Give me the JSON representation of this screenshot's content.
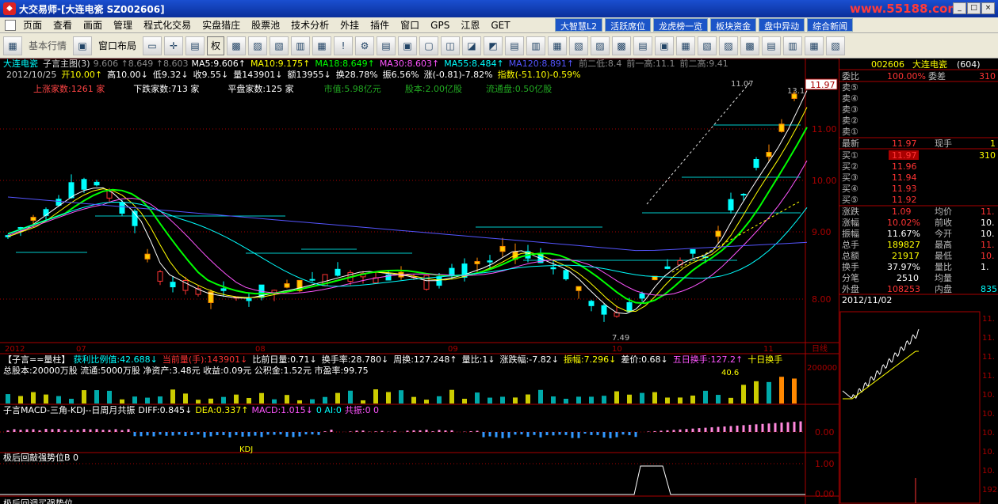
{
  "titlebar": {
    "app": "大交易师",
    "sep": " - ",
    "title": "[大连电瓷 SZ002606]",
    "site": "www.55188.com",
    "btns": [
      "_",
      "□",
      "×"
    ]
  },
  "menu": [
    "页面",
    "查看",
    "画面",
    "管理",
    "程式化交易",
    "实盘猎庄",
    "股票池",
    "技术分析",
    "外挂",
    "插件",
    "窗口",
    "GPS",
    "江恩",
    "GET"
  ],
  "topbtns": [
    "大智慧L2",
    "活跃席位",
    "龙虎榜一览",
    "板块资金",
    "盘中异动",
    "综合新闻"
  ],
  "toolbar": {
    "items": [
      "基本行情",
      "窗口布局",
      "权"
    ]
  },
  "chart_header": {
    "stock": "大连电瓷",
    "main": "子言主图(3)",
    "vals": "9.606 ↑8.649 ↑8.603",
    "ma": [
      {
        "t": "MA5:9.606↑",
        "c": "#ffffff"
      },
      {
        "t": "MA10:9.175↑",
        "c": "#ffff00"
      },
      {
        "t": "MA18:8.649↑",
        "c": "#00ff00"
      },
      {
        "t": "MA30:8.603↑",
        "c": "#ff55ff"
      },
      {
        "t": "MA55:8.484↑",
        "c": "#00ffff"
      },
      {
        "t": "MA120:8.891↑",
        "c": "#5555ff"
      },
      {
        "t": "前二低:8.4",
        "c": "#888888"
      },
      {
        "t": "前一高:11.1",
        "c": "#888888"
      },
      {
        "t": "前二高:9.41",
        "c": "#888888"
      }
    ],
    "row2": [
      {
        "t": "2012/10/25",
        "c": "#cccccc"
      },
      {
        "t": "开10.00↑",
        "c": "#ffff00"
      },
      {
        "t": "高10.00↓",
        "c": "#ffffff"
      },
      {
        "t": "低9.32↓",
        "c": "#ffffff"
      },
      {
        "t": "收9.55↓",
        "c": "#ffffff"
      },
      {
        "t": "量143901↓",
        "c": "#ffffff"
      },
      {
        "t": "额13955↓",
        "c": "#ffffff"
      },
      {
        "t": "换28.78%",
        "c": "#ffffff"
      },
      {
        "t": "振6.56%",
        "c": "#ffffff"
      },
      {
        "t": "涨(-0.81)-7.82%",
        "c": "#ffffff"
      },
      {
        "t": "指数(-51.10)-0.59%",
        "c": "#ffff00"
      }
    ],
    "row3": [
      {
        "t": "上涨家数:1261 家",
        "c": "#ff4444"
      },
      {
        "t": "下跌家数:713 家",
        "c": "#ffffff"
      },
      {
        "t": "平盘家数:125 家",
        "c": "#ffffff"
      },
      {
        "t": "市值:5.98亿元",
        "c": "#22aa22"
      },
      {
        "t": "股本:2.00亿股",
        "c": "#22aa22"
      },
      {
        "t": "流通盘:0.50亿股",
        "c": "#22aa22"
      }
    ]
  },
  "price_axis": [
    "11.00",
    "10.00",
    "9.00",
    "8.00"
  ],
  "price_tag": "11.97",
  "annot": {
    "hi": "11.07",
    "lo": "7.49",
    "r": "13.1"
  },
  "date_axis": [
    "2012",
    "07",
    "08",
    "09",
    "10",
    "11",
    "日线"
  ],
  "vol": {
    "title": "【子言==量柱】",
    "items": [
      {
        "t": "获利比例值:42.688↓",
        "c": "#00ffff"
      },
      {
        "t": "当前量(手):143901↓",
        "c": "#ff3333"
      },
      {
        "t": "比前日量:0.71↓",
        "c": "#ffffff"
      },
      {
        "t": "换手率:28.780↓",
        "c": "#ffffff"
      },
      {
        "t": "周换:127.248↑",
        "c": "#ffffff"
      },
      {
        "t": "量比:1↓",
        "c": "#ffffff"
      },
      {
        "t": "涨跌幅:-7.82↓",
        "c": "#ffffff"
      },
      {
        "t": "振幅:7.296↓",
        "c": "#ffff00"
      },
      {
        "t": "差价:0.68↓",
        "c": "#ffffff"
      },
      {
        "t": "五日换手:127.2↑",
        "c": "#ff55ff"
      },
      {
        "t": "十日换手",
        "c": "#ffff00"
      }
    ],
    "line2": "总股本:20000万股 流通:5000万股 净资产:3.48元 收益:0.09元 公积金:1.52元 市盈率:99.75",
    "axis": "200000",
    "tag": "40.6"
  },
  "macd": {
    "title": "子言MACD-三角-KDJ--日周月共振",
    "diff": "DIFF:0.845↓",
    "dea": "DEA:0.337↑",
    "macdv": "MACD:1.015↓",
    "ai": "0 AI:0",
    "gz": "共振:0 0",
    "axis": "0.00",
    "kdj": "KDJ"
  },
  "ind3": {
    "title": "极后回敲强势位B 0",
    "a1": "1.00",
    "a2": "0.00"
  },
  "ind4": {
    "title": "极后回调买强势位"
  },
  "quote": {
    "code": "002606",
    "name": "大连电瓷",
    "num": "(604)",
    "hdr": [
      {
        "l": "委比",
        "v": "100.00%",
        "l2": "委差",
        "v2": "310"
      }
    ],
    "sell": [
      "卖⑤",
      "卖④",
      "卖③",
      "卖②",
      "卖①"
    ],
    "last": {
      "l": "最新",
      "v": "11.97",
      "l2": "现手",
      "v2": "1"
    },
    "buy": [
      {
        "l": "买①",
        "v": "11.97",
        "v2": "310"
      },
      {
        "l": "买②",
        "v": "11.96"
      },
      {
        "l": "买③",
        "v": "11.94"
      },
      {
        "l": "买④",
        "v": "11.93"
      },
      {
        "l": "买⑤",
        "v": "11.92"
      }
    ],
    "stats": [
      {
        "l": "涨跌",
        "v": "1.09",
        "l2": "均价",
        "v2": "11."
      },
      {
        "l": "涨幅",
        "v": "10.02%",
        "l2": "前收",
        "v2": "10."
      },
      {
        "l": "振幅",
        "v": "11.67%",
        "l2": "今开",
        "v2": "10."
      },
      {
        "l": "总手",
        "v": "189827",
        "l2": "最高",
        "v2": "11."
      },
      {
        "l": "总额",
        "v": "21917",
        "l2": "最低",
        "v2": "10."
      },
      {
        "l": "换手",
        "v": "37.97%",
        "l2": "量比",
        "v2": "1."
      },
      {
        "l": "分笔",
        "v": "2510",
        "l2": "均量",
        "v2": ""
      },
      {
        "l": "外盘",
        "v": "108253",
        "l2": "内盘",
        "v2": "835"
      }
    ],
    "date": "2012/11/02",
    "mini_axis": [
      "11.",
      "11.",
      "11.",
      "11.",
      "10.",
      "10.",
      "10.",
      "10.",
      "10.",
      "1925"
    ]
  },
  "colors": {
    "up": "#ff3333",
    "down": "#00ffff",
    "yellow": "#ffff00",
    "green": "#00ff00",
    "ma30": "#ff55ff",
    "ma55": "#00ffff",
    "ma120": "#5555ff"
  }
}
